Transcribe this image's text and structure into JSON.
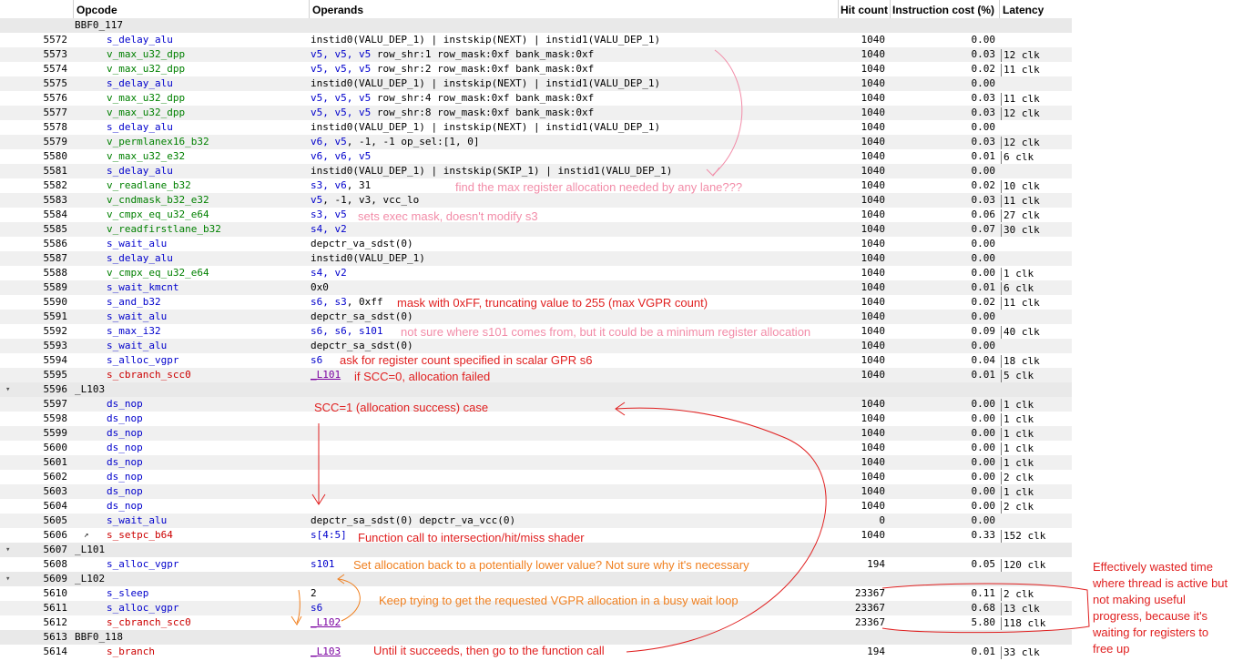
{
  "headers": {
    "opcode": "Opcode",
    "operands": "Operands",
    "hit_count": "Hit count",
    "instruction_cost": "Instruction cost (%)",
    "latency": "Latency"
  },
  "rows": [
    {
      "kind": "label",
      "line": "",
      "label": "BBF0_117",
      "arrow": false
    },
    {
      "kind": "instr",
      "line": "5572",
      "op": "s_delay_alu",
      "opc": "c-blue",
      "operands": "instid0(VALU_DEP_1) | instskip(NEXT) | instid1(VALU_DEP_1)",
      "hit": "1040",
      "cost": "0.00",
      "lat": ""
    },
    {
      "kind": "instr",
      "line": "5573",
      "op": "v_max_u32_dpp",
      "opc": "c-green",
      "regs": "v5, v5, v5",
      "operands": " row_shr:1 row_mask:0xf bank_mask:0xf",
      "hit": "1040",
      "cost": "0.03",
      "lat": "12 clk"
    },
    {
      "kind": "instr",
      "line": "5574",
      "op": "v_max_u32_dpp",
      "opc": "c-green",
      "regs": "v5, v5, v5",
      "operands": " row_shr:2 row_mask:0xf bank_mask:0xf",
      "hit": "1040",
      "cost": "0.02",
      "lat": "11 clk"
    },
    {
      "kind": "instr",
      "line": "5575",
      "op": "s_delay_alu",
      "opc": "c-blue",
      "operands": "instid0(VALU_DEP_1) | instskip(NEXT) | instid1(VALU_DEP_1)",
      "hit": "1040",
      "cost": "0.00",
      "lat": ""
    },
    {
      "kind": "instr",
      "line": "5576",
      "op": "v_max_u32_dpp",
      "opc": "c-green",
      "regs": "v5, v5, v5",
      "operands": " row_shr:4 row_mask:0xf bank_mask:0xf",
      "hit": "1040",
      "cost": "0.03",
      "lat": "11 clk"
    },
    {
      "kind": "instr",
      "line": "5577",
      "op": "v_max_u32_dpp",
      "opc": "c-green",
      "regs": "v5, v5, v5",
      "operands": " row_shr:8 row_mask:0xf bank_mask:0xf",
      "hit": "1040",
      "cost": "0.03",
      "lat": "12 clk"
    },
    {
      "kind": "instr",
      "line": "5578",
      "op": "s_delay_alu",
      "opc": "c-blue",
      "operands": "instid0(VALU_DEP_1) | instskip(NEXT) | instid1(VALU_DEP_1)",
      "hit": "1040",
      "cost": "0.00",
      "lat": ""
    },
    {
      "kind": "instr",
      "line": "5579",
      "op": "v_permlanex16_b32",
      "opc": "c-green",
      "regs": "v6, v5",
      "operands": ", -1, -1 op_sel:[1, 0]",
      "hit": "1040",
      "cost": "0.03",
      "lat": "12 clk"
    },
    {
      "kind": "instr",
      "line": "5580",
      "op": "v_max_u32_e32",
      "opc": "c-green",
      "regs": "v6, v6, v5",
      "operands": "",
      "hit": "1040",
      "cost": "0.01",
      "lat": "6 clk"
    },
    {
      "kind": "instr",
      "line": "5581",
      "op": "s_delay_alu",
      "opc": "c-blue",
      "operands": "instid0(VALU_DEP_1) | instskip(SKIP_1) | instid1(VALU_DEP_1)",
      "hit": "1040",
      "cost": "0.00",
      "lat": ""
    },
    {
      "kind": "instr",
      "line": "5582",
      "op": "v_readlane_b32",
      "opc": "c-green",
      "regs": "s3, v6",
      "operands": ", 31",
      "hit": "1040",
      "cost": "0.02",
      "lat": "10 clk"
    },
    {
      "kind": "instr",
      "line": "5583",
      "op": "v_cndmask_b32_e32",
      "opc": "c-green",
      "regs": "v5",
      "operands": ", -1, v3, vcc_lo",
      "regs2": "",
      "hit": "1040",
      "cost": "0.03",
      "lat": "11 clk"
    },
    {
      "kind": "instr",
      "line": "5584",
      "op": "v_cmpx_eq_u32_e64",
      "opc": "c-green",
      "regs": "s3, v5",
      "operands": "",
      "hit": "1040",
      "cost": "0.06",
      "lat": "27 clk"
    },
    {
      "kind": "instr",
      "line": "5585",
      "op": "v_readfirstlane_b32",
      "opc": "c-green",
      "regs": "s4, v2",
      "operands": "",
      "hit": "1040",
      "cost": "0.07",
      "lat": "30 clk"
    },
    {
      "kind": "instr",
      "line": "5586",
      "op": "s_wait_alu",
      "opc": "c-blue",
      "operands": "depctr_va_sdst(0)",
      "hit": "1040",
      "cost": "0.00",
      "lat": ""
    },
    {
      "kind": "instr",
      "line": "5587",
      "op": "s_delay_alu",
      "opc": "c-blue",
      "operands": "instid0(VALU_DEP_1)",
      "hit": "1040",
      "cost": "0.00",
      "lat": ""
    },
    {
      "kind": "instr",
      "line": "5588",
      "op": "v_cmpx_eq_u32_e64",
      "opc": "c-green",
      "regs": "s4, v2",
      "operands": "",
      "hit": "1040",
      "cost": "0.00",
      "lat": "1 clk"
    },
    {
      "kind": "instr",
      "line": "5589",
      "op": "s_wait_kmcnt",
      "opc": "c-blue",
      "operands": "0x0",
      "hit": "1040",
      "cost": "0.01",
      "lat": "6 clk"
    },
    {
      "kind": "instr",
      "line": "5590",
      "op": "s_and_b32",
      "opc": "c-blue",
      "regs": "s6, s3",
      "operands": ", 0xff",
      "hit": "1040",
      "cost": "0.02",
      "lat": "11 clk"
    },
    {
      "kind": "instr",
      "line": "5591",
      "op": "s_wait_alu",
      "opc": "c-blue",
      "operands": "depctr_sa_sdst(0)",
      "hit": "1040",
      "cost": "0.00",
      "lat": ""
    },
    {
      "kind": "instr",
      "line": "5592",
      "op": "s_max_i32",
      "opc": "c-blue",
      "regs": "s6, s6, s101",
      "operands": "",
      "hit": "1040",
      "cost": "0.09",
      "lat": "40 clk"
    },
    {
      "kind": "instr",
      "line": "5593",
      "op": "s_wait_alu",
      "opc": "c-blue",
      "operands": "depctr_sa_sdst(0)",
      "hit": "1040",
      "cost": "0.00",
      "lat": ""
    },
    {
      "kind": "instr",
      "line": "5594",
      "op": "s_alloc_vgpr",
      "opc": "c-blue",
      "regs": "s6",
      "operands": "",
      "hit": "1040",
      "cost": "0.04",
      "lat": "18 clk"
    },
    {
      "kind": "instr",
      "line": "5595",
      "op": "s_cbranch_scc0",
      "opc": "c-red",
      "link": "_L101",
      "operands": "",
      "hit": "1040",
      "cost": "0.01",
      "lat": "5 clk"
    },
    {
      "kind": "label",
      "line": "5596",
      "label": "_L103",
      "arrow": true
    },
    {
      "kind": "instr",
      "line": "5597",
      "op": "ds_nop",
      "opc": "c-blue",
      "operands": "",
      "hit": "1040",
      "cost": "0.00",
      "lat": "1 clk"
    },
    {
      "kind": "instr",
      "line": "5598",
      "op": "ds_nop",
      "opc": "c-blue",
      "operands": "",
      "hit": "1040",
      "cost": "0.00",
      "lat": "1 clk"
    },
    {
      "kind": "instr",
      "line": "5599",
      "op": "ds_nop",
      "opc": "c-blue",
      "operands": "",
      "hit": "1040",
      "cost": "0.00",
      "lat": "1 clk"
    },
    {
      "kind": "instr",
      "line": "5600",
      "op": "ds_nop",
      "opc": "c-blue",
      "operands": "",
      "hit": "1040",
      "cost": "0.00",
      "lat": "1 clk"
    },
    {
      "kind": "instr",
      "line": "5601",
      "op": "ds_nop",
      "opc": "c-blue",
      "operands": "",
      "hit": "1040",
      "cost": "0.00",
      "lat": "1 clk"
    },
    {
      "kind": "instr",
      "line": "5602",
      "op": "ds_nop",
      "opc": "c-blue",
      "operands": "",
      "hit": "1040",
      "cost": "0.00",
      "lat": "2 clk"
    },
    {
      "kind": "instr",
      "line": "5603",
      "op": "ds_nop",
      "opc": "c-blue",
      "operands": "",
      "hit": "1040",
      "cost": "0.00",
      "lat": "1 clk"
    },
    {
      "kind": "instr",
      "line": "5604",
      "op": "ds_nop",
      "opc": "c-blue",
      "operands": "",
      "hit": "1040",
      "cost": "0.00",
      "lat": "2 clk"
    },
    {
      "kind": "instr",
      "line": "5605",
      "op": "s_wait_alu",
      "opc": "c-blue",
      "operands": "depctr_sa_sdst(0) depctr_va_vcc(0)",
      "hit": "0",
      "cost": "0.00",
      "lat": ""
    },
    {
      "kind": "instr",
      "line": "5606",
      "op": "s_setpc_b64",
      "opc": "c-red",
      "regs": "s[4:5]",
      "operands": "",
      "hit": "1040",
      "cost": "0.33",
      "lat": "152 clk",
      "cursor": true
    },
    {
      "kind": "label",
      "line": "5607",
      "label": "_L101",
      "arrow": true
    },
    {
      "kind": "instr",
      "line": "5608",
      "op": "s_alloc_vgpr",
      "opc": "c-blue",
      "regs": "s101",
      "operands": "",
      "hit": "194",
      "cost": "0.05",
      "lat": "120 clk"
    },
    {
      "kind": "label",
      "line": "5609",
      "label": "_L102",
      "arrow": true
    },
    {
      "kind": "instr",
      "line": "5610",
      "op": "s_sleep",
      "opc": "c-blue",
      "operands": "2",
      "hit": "23367",
      "cost": "0.11",
      "lat": "2 clk"
    },
    {
      "kind": "instr",
      "line": "5611",
      "op": "s_alloc_vgpr",
      "opc": "c-blue",
      "regs": "s6",
      "operands": "",
      "hit": "23367",
      "cost": "0.68",
      "lat": "13 clk"
    },
    {
      "kind": "instr",
      "line": "5612",
      "op": "s_cbranch_scc0",
      "opc": "c-red",
      "link": "_L102",
      "operands": "",
      "hit": "23367",
      "cost": "5.80",
      "lat": "118 clk"
    },
    {
      "kind": "label",
      "line": "5613",
      "label": "BBF0_118",
      "arrow": false
    },
    {
      "kind": "instr",
      "line": "5614",
      "op": "s_branch",
      "opc": "c-red",
      "link": "_L103",
      "operands": "",
      "hit": "194",
      "cost": "0.01",
      "lat": "33 clk"
    }
  ],
  "annotations": {
    "max_reg": "find the max register allocation needed by any lane???",
    "exec_mask": "sets exec mask, doesn't modify s3",
    "mask_ff": "mask with 0xFF, truncating value to 255 (max VGPR count)",
    "s101": "not sure where s101 comes from, but it could be a minimum register allocation",
    "ask_count": "ask for register count specified in scalar GPR s6",
    "scc0_fail": "if SCC=0, allocation failed",
    "scc1_success": "SCC=1 (allocation success) case",
    "function_call": "Function call to intersection/hit/miss shader",
    "set_back": "Set allocation back to a potentially lower value? Not sure why it's necessary",
    "keep_trying": "Keep trying to get the requested VGPR allocation in a busy wait loop",
    "until_succeeds": "Until it succeeds, then go to the function call",
    "wasted_time": "Effectively wasted time where thread is active but not making useful progress, because it's waiting for registers to free up"
  },
  "colors": {
    "opcode_blue": "#0000cc",
    "opcode_green": "#008000",
    "opcode_red": "#cc0000",
    "annotation_pink": "#f28ca8",
    "annotation_red": "#e02020",
    "annotation_orange": "#f08020"
  }
}
